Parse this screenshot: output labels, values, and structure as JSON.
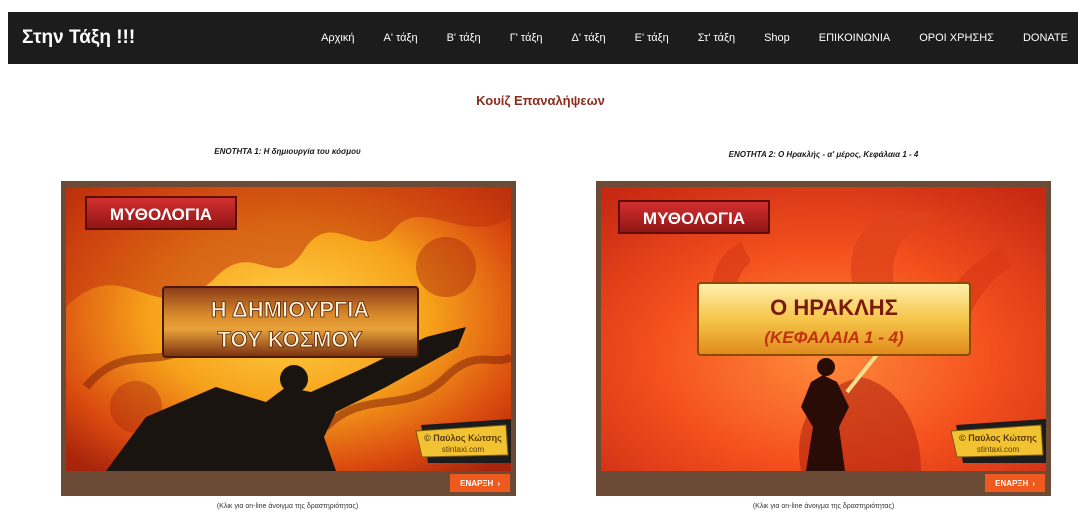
{
  "brand": "Στην Τάξη !!!",
  "nav": [
    "Αρχική",
    "Α' τάξη",
    "Β' τάξη",
    "Γ' τάξη",
    "Δ' τάξη",
    "Ε' τάξη",
    "Στ' τάξη",
    "Shop",
    "ΕΠΙΚΟΙΝΩΝΙΑ",
    "ΟΡΟΙ ΧΡΗΣΗΣ",
    "DONATE"
  ],
  "heading": "Κουίζ Επαναλήψεων",
  "quizzes": [
    {
      "caption": "ΕΝΟΤΗΤΑ 1: Η δημιουργία του κόσμου",
      "badge": "ΜΥΘΟΛΟΓΙΑ",
      "title_line1": "Η ΔΗΜΙΟΥΡΓΙΑ",
      "title_line2": "ΤΟΥ ΚΟΣΜΟΥ",
      "credit_line1": "© Παύλος Κώτσης",
      "credit_line2": "stintaxi.com",
      "button": "ΕΝΑΡΞΗ",
      "note": "(Κλικ για on-line άνοιγμα της δραστηριότητας)"
    },
    {
      "caption": "ΕΝΟΤΗΤΑ 2: Ο Ηρακλής - α' μέρος, Κεφάλαια 1 - 4",
      "badge": "ΜΥΘΟΛΟΓΙΑ",
      "title_line1": "Ο ΗΡΑΚΛΗΣ",
      "title_line2": "(ΚΕΦΑΛΑΙΑ 1 - 4)",
      "credit_line1": "© Παύλος Κώτσης",
      "credit_line2": "stintaxi.com",
      "button": "ΕΝΑΡΞΗ",
      "note": "(Κλικ για on-line άνοιγμα της δραστηριότητας)"
    }
  ],
  "colors": {
    "navbar": "#1c1c1c",
    "heading": "#8b2d1f",
    "frame": "#6b4a36",
    "button": "#ee5a1e"
  }
}
